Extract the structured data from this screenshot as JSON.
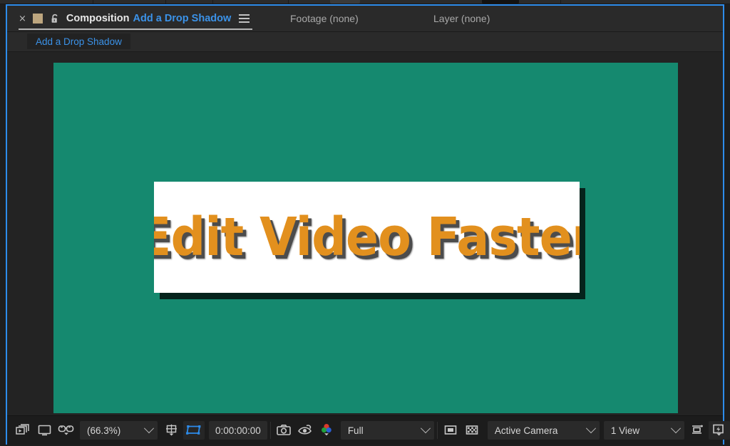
{
  "panel": {
    "focus_color": "#2d8ceb"
  },
  "tabs": {
    "close_glyph": "×",
    "swatch_color": "#bda67f",
    "lock_icon": "unlock-icon",
    "menu_icon": "panel-menu-icon",
    "active": {
      "title": "Composition",
      "comp_name": "Add a Drop Shadow"
    },
    "footage": "Footage (none)",
    "layer": "Layer (none)"
  },
  "subbar": {
    "comp_tab_label": "Add a Drop Shadow"
  },
  "canvas": {
    "background_color": "#15896f",
    "card": {
      "background_color": "#ffffff",
      "shadow_color": "#05231c",
      "text": "Edit Video Faster",
      "text_color": "#e2901e",
      "text_shadow_color": "#4c4c4c"
    }
  },
  "toolbar": {
    "always_preview_icon": "always-preview-this-view-icon",
    "main_viewer_icon": "main-viewer-icon",
    "threed_glasses_icon": "3d-glasses-icon",
    "magnification": "(66.3%)",
    "choose_grid_icon": "choose-grid-and-guide-options-icon",
    "region_of_interest_icon": "region-of-interest-icon",
    "region_of_interest_active": true,
    "timecode": "0:00:00:00",
    "snapshot_icon": "take-snapshot-icon",
    "show_snapshot_icon": "show-snapshot-icon",
    "channels_icon": "show-channel-icon",
    "resolution": "Full",
    "transparency_grid_icon": "toggle-transparency-grid-icon",
    "alpha_checker_icon": "toggle-alpha-boundaries-icon",
    "camera": "Active Camera",
    "views": "1 View",
    "pixel_aspect_icon": "toggle-pixel-aspect-correction-icon",
    "fast_previews_icon": "fast-previews-icon",
    "timeline_icon": "timeline-icon",
    "flowchart_icon": "composition-flowchart-icon",
    "renderer_icon": "renderer-options-icon"
  }
}
